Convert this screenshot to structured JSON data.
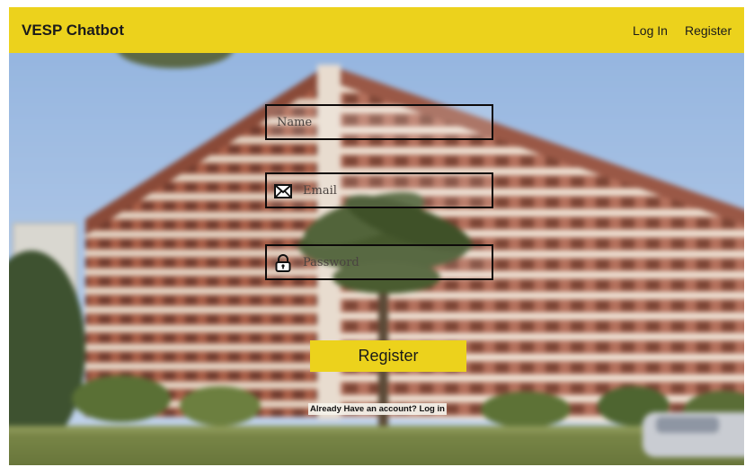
{
  "header": {
    "brand": "VESP Chatbot",
    "login_label": "Log In",
    "register_label": "Register"
  },
  "form": {
    "name_placeholder": "Name",
    "email_placeholder": "Email",
    "password_placeholder": "Password",
    "submit_label": "Register",
    "already_prefix": "Already Have an account? ",
    "login_link": "Log in"
  },
  "icons": {
    "email": "envelope-icon",
    "password": "padlock-icon"
  },
  "colors": {
    "accent": "#ecd21c",
    "field_border": "#0d0a0a",
    "text": "#1b1b1b"
  }
}
